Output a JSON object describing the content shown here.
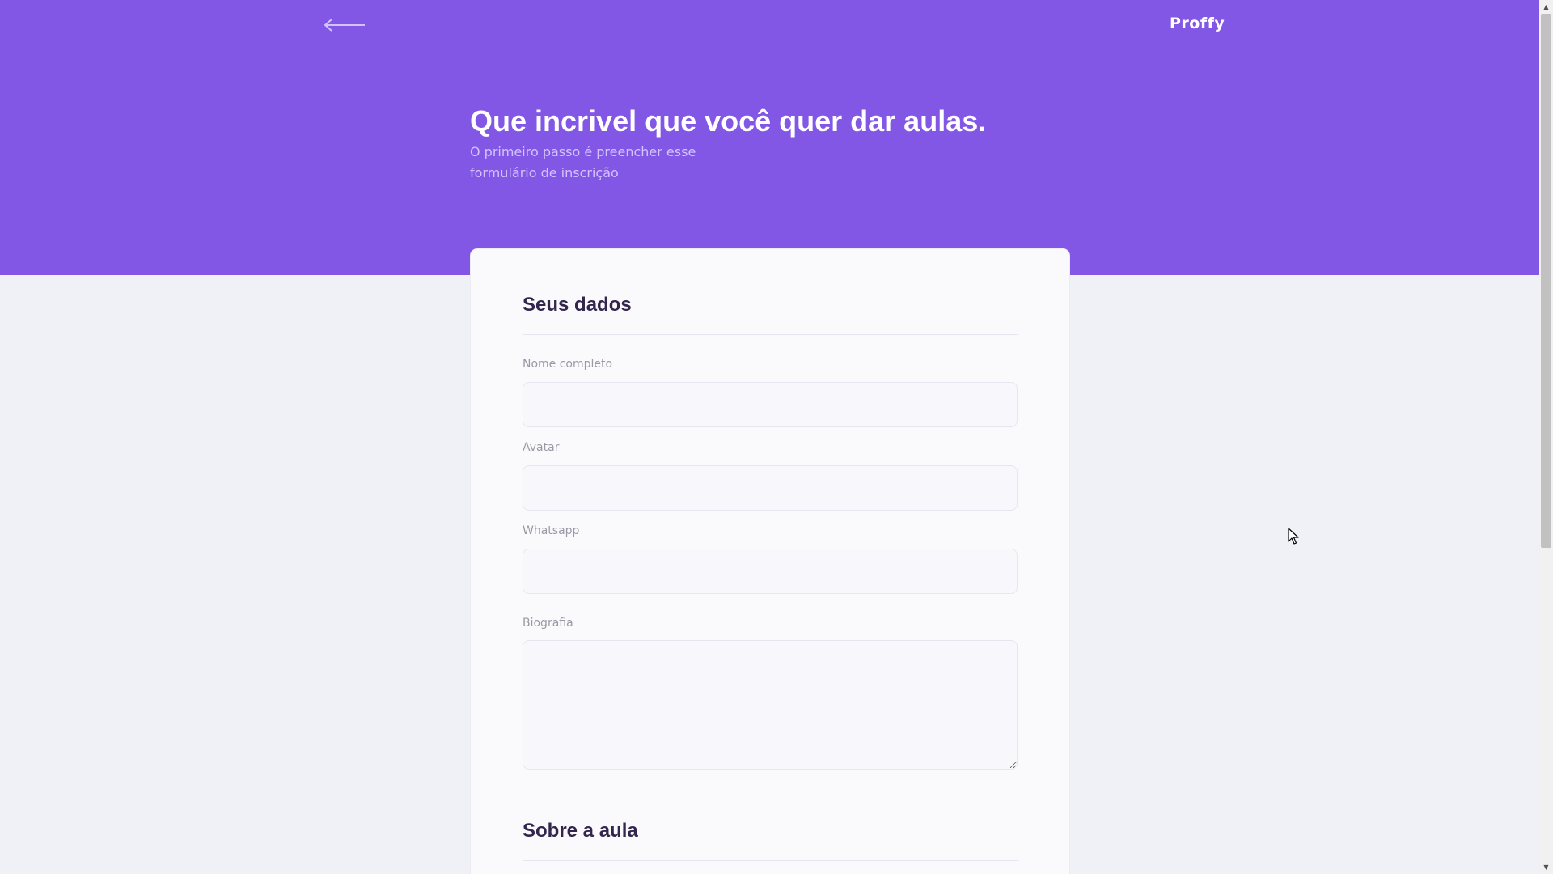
{
  "header": {
    "back_icon": "arrow-left-icon",
    "logo": "Proffy"
  },
  "hero": {
    "title": "Que incrivel que você quer dar aulas.",
    "subtitle": "O primeiro passo é preencher esse formulário de inscrição"
  },
  "form": {
    "section_personal": "Seus dados",
    "name_label": "Nome completo",
    "name_value": "",
    "avatar_label": "Avatar",
    "avatar_value": "",
    "whatsapp_label": "Whatsapp",
    "whatsapp_value": "",
    "bio_label": "Biografia",
    "bio_value": "",
    "section_class": "Sobre a aula"
  },
  "colors": {
    "primary": "#8257E5",
    "background": "#F0F0F7",
    "card": "#FAFAFC",
    "title_text": "#32264D",
    "label_text": "#9C98A6"
  }
}
